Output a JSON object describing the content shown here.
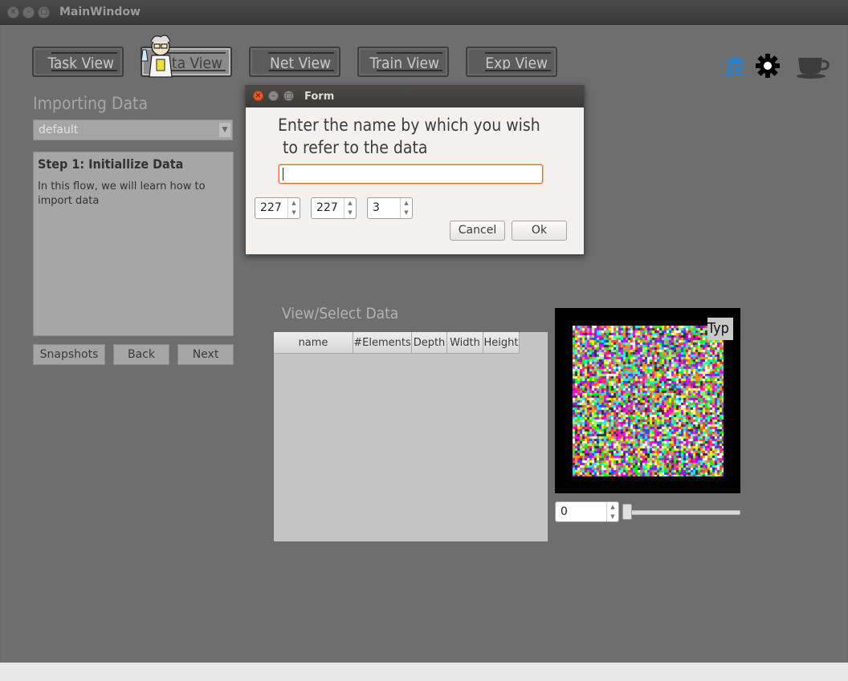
{
  "window": {
    "title": "MainWindow"
  },
  "nav": {
    "task": "Task View",
    "data": "Data View",
    "net": "Net View",
    "train": "Train View",
    "exp": "Exp View"
  },
  "icons": [
    "bank-icon",
    "gear-icon",
    "coffee-cup-icon"
  ],
  "left": {
    "section_title": "Importing Data",
    "combo_value": "default",
    "step_title": "Step 1: Initiallize Data",
    "step_body": "In this flow, we will learn how to import data",
    "snapshots": "Snapshots",
    "back": "Back",
    "next": "Next"
  },
  "data_panel": {
    "title": "View/Select  Data",
    "columns": [
      "name",
      "#Elements",
      "Depth",
      "Width",
      "Height"
    ],
    "preview_label": "Typ",
    "index_value": "0",
    "slider_value": 0
  },
  "dialog": {
    "title": "Form",
    "prompt": "Enter the name by which you wish\n to refer to the data",
    "name_value": "",
    "dim1": "227",
    "dim2": "227",
    "dim3": "3",
    "cancel": "Cancel",
    "ok": "Ok"
  },
  "colors": {
    "accent_blue": "#2a7fc7",
    "input_focus": "#e0703c",
    "close_btn": "#e25a2b"
  }
}
